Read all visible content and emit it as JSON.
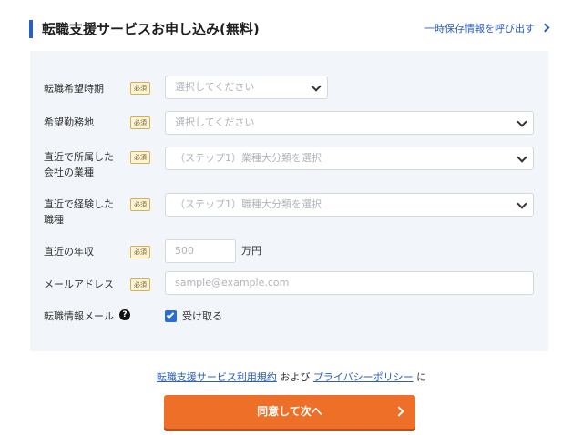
{
  "header": {
    "title": "転職支援サービスお申し込み(無料)",
    "save_link": "一時保存情報を呼び出す"
  },
  "required_badge": "必須",
  "fields": {
    "timing": {
      "label": "転職希望時期",
      "placeholder": "選択してください"
    },
    "location": {
      "label": "希望勤務地",
      "placeholder": "選択してください"
    },
    "industry": {
      "label_line1": "直近で所属した",
      "label_line2": "会社の業種",
      "placeholder": "（ステップ1）業種大分類を選択"
    },
    "job_type": {
      "label_line1": "直近で経験した",
      "label_line2": "職種",
      "placeholder": "（ステップ1）職種大分類を選択"
    },
    "income": {
      "label": "直近の年収",
      "placeholder": "500",
      "unit": "万円"
    },
    "email": {
      "label": "メールアドレス",
      "placeholder": "sample@example.com"
    },
    "newsletter": {
      "label": "転職情報メール",
      "help_icon": "question-circle-icon",
      "checkbox_label": "受け取る",
      "checked": true
    }
  },
  "terms": {
    "link1": "転職支援サービス利用規約",
    "and": "および",
    "link2": "プライバシーポリシー",
    "suffix": "に"
  },
  "submit": {
    "label": "同意して次へ"
  },
  "colors": {
    "accent": "#2b5fbd",
    "submit": "#ee6f28",
    "panel": "#f2f6fa"
  }
}
